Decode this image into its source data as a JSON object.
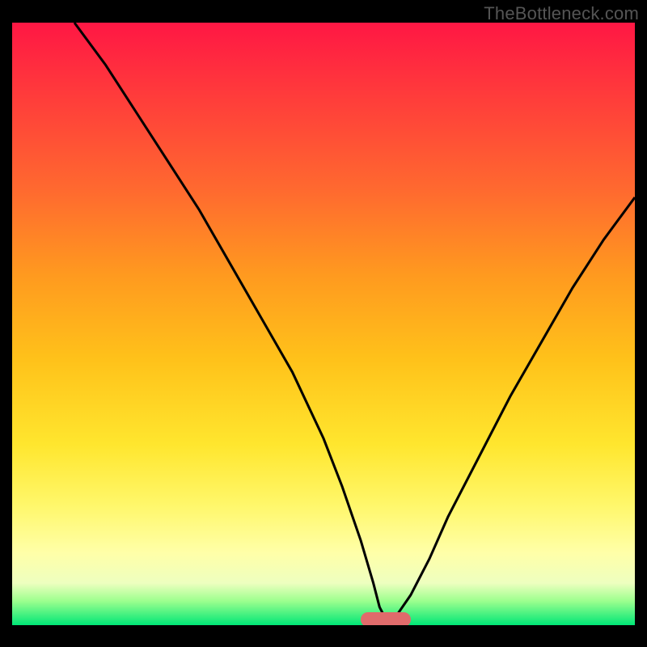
{
  "watermark": "TheBottleneck.com",
  "chart_data": {
    "type": "line",
    "title": "",
    "xlabel": "",
    "ylabel": "",
    "xlim": [
      0,
      100
    ],
    "ylim": [
      0,
      100
    ],
    "grid": false,
    "series": [
      {
        "name": "curve",
        "x": [
          10,
          15,
          20,
          25,
          30,
          35,
          40,
          45,
          50,
          53,
          56,
          58,
          59,
          60,
          61,
          62,
          64,
          67,
          70,
          75,
          80,
          85,
          90,
          95,
          100
        ],
        "values": [
          100,
          93,
          85,
          77,
          69,
          60,
          51,
          42,
          31,
          23,
          14,
          7,
          3,
          1,
          1,
          2,
          5,
          11,
          18,
          28,
          38,
          47,
          56,
          64,
          71
        ]
      }
    ],
    "annotations": [
      {
        "type": "marker",
        "shape": "rounded-bar",
        "x": 60,
        "y": 1,
        "color": "#e06b6b"
      }
    ],
    "background_gradient": {
      "direction": "vertical",
      "stops": [
        {
          "pos": 0,
          "color": "#ff1744"
        },
        {
          "pos": 28,
          "color": "#ff6a2f"
        },
        {
          "pos": 56,
          "color": "#ffc21a"
        },
        {
          "pos": 80,
          "color": "#fff76a"
        },
        {
          "pos": 93,
          "color": "#eeffbf"
        },
        {
          "pos": 100,
          "color": "#00e676"
        }
      ]
    }
  }
}
